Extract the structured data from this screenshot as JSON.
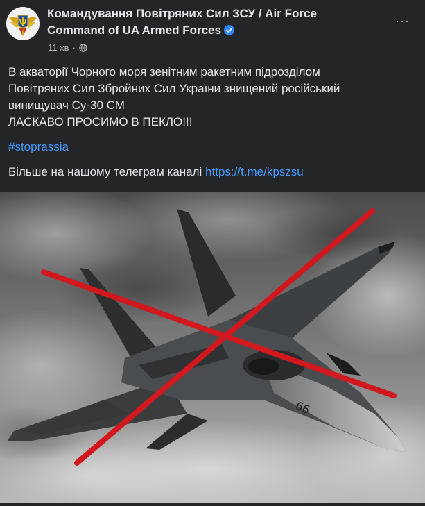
{
  "post": {
    "author": "Командування Повітряних Сил ЗСУ / Air Force Command of UA Armed Forces",
    "timestamp": "11 хв",
    "separator": "·",
    "privacy_icon": "globe-icon",
    "verified_icon": "verified-badge-icon",
    "more_icon": "more-options-icon",
    "more_label": "···",
    "text_lines": [
      "В акваторії Чорного моря зенітним ракетним підрозділом",
      "Повітряних Сил Збройних Сил України знищений російський",
      "винищувач Су-30 СМ",
      "ЛАСКАВО ПРОСИМО В ПЕКЛО!!!"
    ],
    "hashtag": "#stoprassia",
    "telegram_text": "Більше на нашому телеграм каналі ",
    "telegram_link": "https://t.me/kpszsu"
  },
  "photo": {
    "subject": "fighter jet crossed out",
    "cross_color": "#d0181e",
    "tail_number": "66"
  },
  "colors": {
    "background": "#242526",
    "text": "#e4e6eb",
    "secondary_text": "#b0b3b8",
    "link": "#4599ff",
    "verified": "#2d88ff"
  }
}
